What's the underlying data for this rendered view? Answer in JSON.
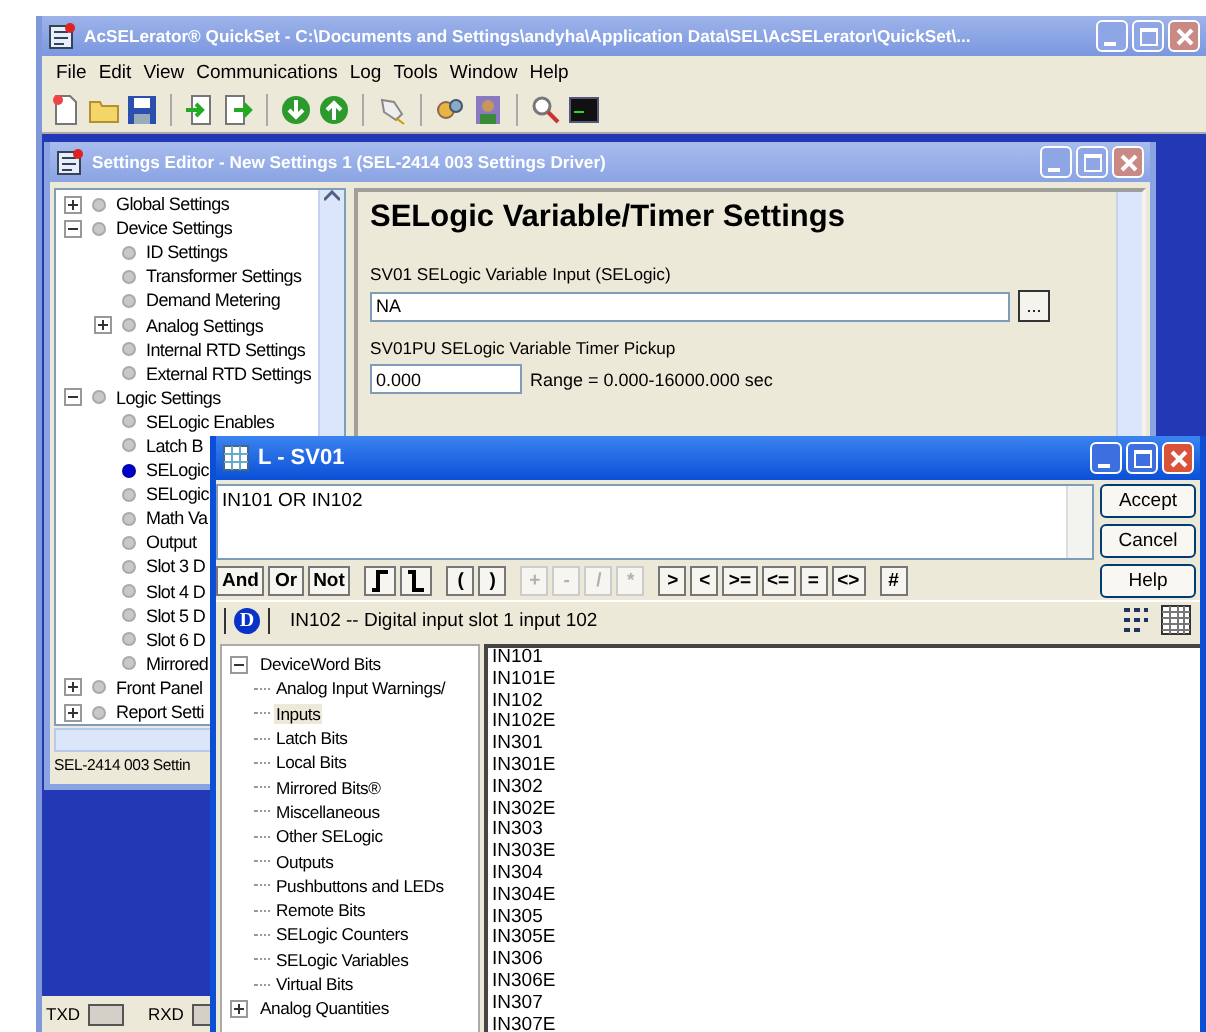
{
  "app_window": {
    "title": "AcSELerator® QuickSet - C:\\Documents and Settings\\andyha\\Application Data\\SEL\\AcSELerator\\QuickSet\\...",
    "menu": [
      "File",
      "Edit",
      "View",
      "Communications",
      "Log",
      "Tools",
      "Window",
      "Help"
    ],
    "status_bar": {
      "txd": "TXD",
      "rxd": "RXD"
    }
  },
  "settings_editor": {
    "title": "Settings Editor - New Settings 1 (SEL-2414 003 Settings Driver)",
    "tree": [
      {
        "label": "Global Settings",
        "expanded": false,
        "selected": false
      },
      {
        "label": "Device Settings",
        "expanded": true,
        "selected": false,
        "children": [
          {
            "label": "ID Settings",
            "selected": false
          },
          {
            "label": "Transformer Settings",
            "selected": false
          },
          {
            "label": "Demand Metering",
            "selected": false
          },
          {
            "label": "Analog Settings",
            "expanded": false,
            "selected": false
          },
          {
            "label": "Internal RTD Settings",
            "selected": false
          },
          {
            "label": "External RTD Settings",
            "selected": false
          }
        ]
      },
      {
        "label": "Logic Settings",
        "expanded": true,
        "selected": false,
        "children": [
          {
            "label": "SELogic Enables",
            "selected": false
          },
          {
            "label": "Latch B",
            "selected": false
          },
          {
            "label": "SELogic",
            "selected": true
          },
          {
            "label": "SELogic",
            "selected": false
          },
          {
            "label": "Math Va",
            "selected": false
          },
          {
            "label": "Output",
            "selected": false
          },
          {
            "label": "Slot 3 D",
            "selected": false
          },
          {
            "label": "Slot 4 D",
            "selected": false
          },
          {
            "label": "Slot 5 D",
            "selected": false
          },
          {
            "label": "Slot 6 D",
            "selected": false
          },
          {
            "label": "Mirrored",
            "selected": false
          }
        ]
      },
      {
        "label": "Front Panel",
        "expanded": false,
        "selected": false
      },
      {
        "label": "Report Setti",
        "expanded": false,
        "selected": false
      }
    ],
    "status": "SEL-2414 003 Settin",
    "panel": {
      "heading": "SELogic Variable/Timer Settings",
      "fields": [
        {
          "kind": "selogic",
          "label": "SV01 SELogic Variable Input (SELogic)",
          "value": "NA",
          "button": "..."
        },
        {
          "kind": "number",
          "label": "SV01PU SELogic Variable Timer Pickup",
          "value": "0.000",
          "note": "Range = 0.000-16000.000 sec"
        }
      ]
    }
  },
  "dialog": {
    "title": "L - SV01",
    "expression": "IN101 OR IN102",
    "buttons": [
      "Accept",
      "Cancel",
      "Help"
    ],
    "operators": [
      {
        "kind": "text",
        "label": "And",
        "disabled": false
      },
      {
        "kind": "text",
        "label": "Or",
        "disabled": false
      },
      {
        "kind": "text",
        "label": "Not",
        "disabled": false
      },
      {
        "kind": "rising_edge",
        "disabled": false
      },
      {
        "kind": "falling_edge",
        "disabled": false
      },
      {
        "kind": "text",
        "label": "(",
        "disabled": false
      },
      {
        "kind": "text",
        "label": ")",
        "disabled": false
      },
      {
        "kind": "text",
        "label": "+",
        "disabled": true
      },
      {
        "kind": "text",
        "label": "-",
        "disabled": true
      },
      {
        "kind": "text",
        "label": "/",
        "disabled": true
      },
      {
        "kind": "text",
        "label": "*",
        "disabled": true
      },
      {
        "kind": "text",
        "label": ">",
        "disabled": false
      },
      {
        "kind": "text",
        "label": "<",
        "disabled": false
      },
      {
        "kind": "text",
        "label": ">=",
        "disabled": false
      },
      {
        "kind": "text",
        "label": "<=",
        "disabled": false
      },
      {
        "kind": "text",
        "label": "=",
        "disabled": false
      },
      {
        "kind": "text",
        "label": "<>",
        "disabled": false
      },
      {
        "kind": "text",
        "label": "#",
        "disabled": false
      }
    ],
    "info": {
      "badge": "D",
      "text": "IN102 -- Digital input slot 1 input 102"
    },
    "tree": [
      {
        "label": "DeviceWord Bits",
        "expanded": true,
        "selected": false,
        "children": [
          {
            "label": "Analog Input Warnings/",
            "selected": false
          },
          {
            "label": "Inputs",
            "selected": true
          },
          {
            "label": "Latch Bits",
            "selected": false
          },
          {
            "label": "Local Bits",
            "selected": false
          },
          {
            "label": "Mirrored Bits®",
            "selected": false
          },
          {
            "label": "Miscellaneous",
            "selected": false
          },
          {
            "label": "Other SELogic",
            "selected": false
          },
          {
            "label": "Outputs",
            "selected": false
          },
          {
            "label": "Pushbuttons and LEDs",
            "selected": false
          },
          {
            "label": "Remote Bits",
            "selected": false
          },
          {
            "label": "SELogic Counters",
            "selected": false
          },
          {
            "label": "SELogic Variables",
            "selected": false
          },
          {
            "label": "Virtual Bits",
            "selected": false
          }
        ]
      },
      {
        "label": "Analog Quantities",
        "expanded": false,
        "selected": false
      }
    ],
    "list": [
      "IN101",
      "IN101E",
      "IN102",
      "IN102E",
      "IN301",
      "IN301E",
      "IN302",
      "IN302E",
      "IN303",
      "IN303E",
      "IN304",
      "IN304E",
      "IN305",
      "IN305E",
      "IN306",
      "IN306E",
      "IN307",
      "IN307E"
    ]
  }
}
